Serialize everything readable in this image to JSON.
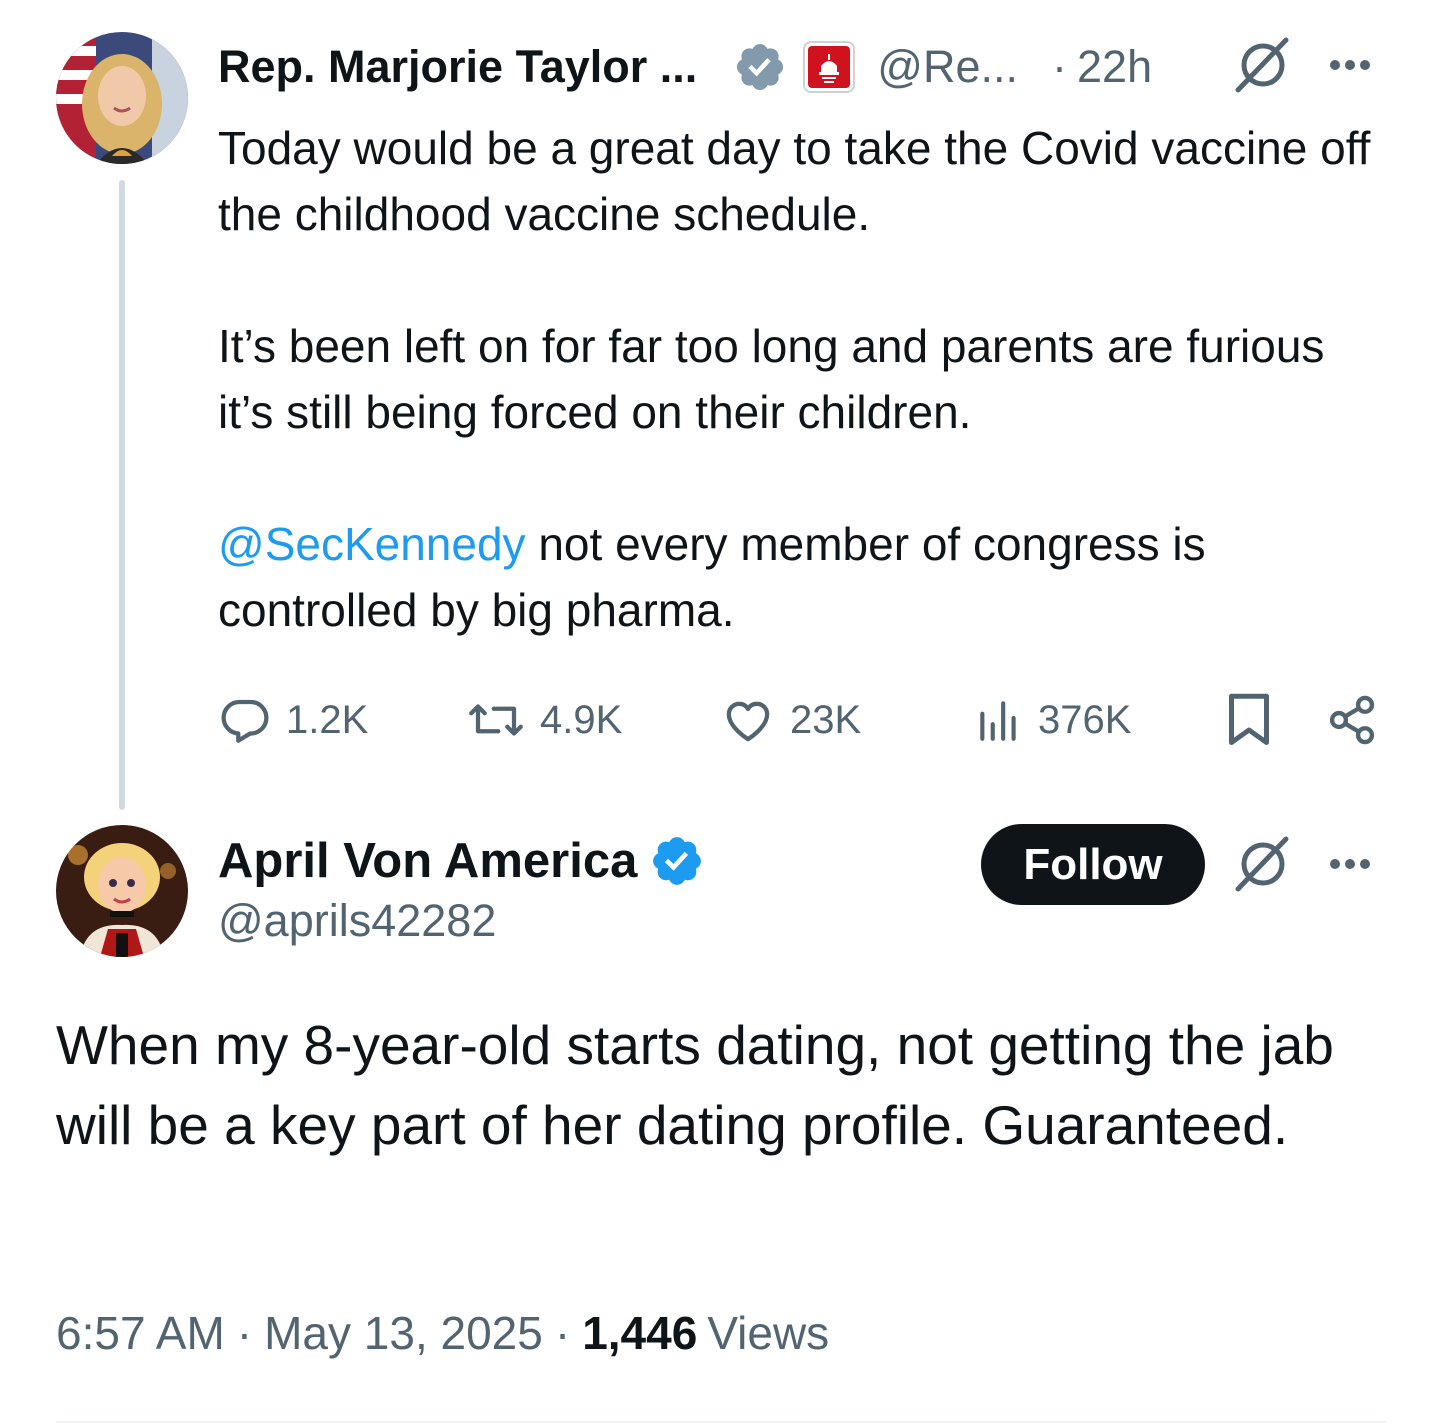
{
  "parent_tweet": {
    "author_name": "Rep. Marjorie Taylor ...",
    "handle": "@Re...",
    "time_separator": "·",
    "time": "22h",
    "paragraphs": [
      "Today would be a great day to take the Covid vaccine off the childhood vaccine schedule.",
      "It’s been left on for far too long and parents are furious it’s still being forced on their children."
    ],
    "mention": "@SecKennedy",
    "mention_tail": " not every member of congress is controlled by big pharma.",
    "stats": {
      "replies": "1.2K",
      "reposts": "4.9K",
      "likes": "23K",
      "views": "376K"
    }
  },
  "reply_tweet": {
    "author_name": "April Von America",
    "handle": "@aprils42282",
    "follow_label": "Follow",
    "text": "When my 8-year-old starts dating, not getting the jab will be a key part of her dating profile. Guaranteed.",
    "time": "6:57 AM",
    "sep": "·",
    "date": "May 13, 2025",
    "views_count": "1,446",
    "views_label": "Views"
  },
  "colors": {
    "link": "#1d9bf0",
    "verified_blue": "#1d9bf0",
    "verified_grey": "#829aab",
    "secondary_text": "#536471",
    "primary_text": "#0f1419",
    "thread_line": "#cfd9de"
  },
  "icons": {
    "verified_grey": "verified-grey-badge-icon",
    "verified_blue": "verified-blue-badge-icon",
    "gov_affiliate": "house-gop-affiliate-icon",
    "grok": "grok-icon",
    "more": "more-dots-icon",
    "reply": "reply-icon",
    "repost": "repost-icon",
    "like": "heart-icon",
    "views": "views-chart-icon",
    "bookmark": "bookmark-icon",
    "share": "share-icon"
  }
}
